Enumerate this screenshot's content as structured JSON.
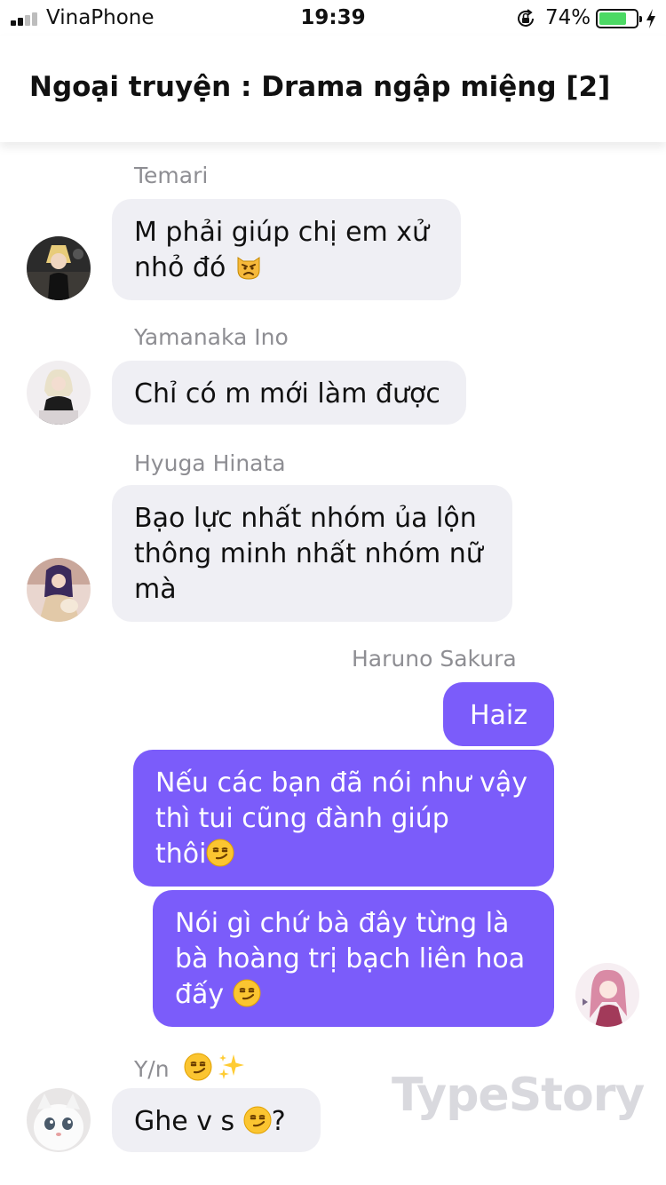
{
  "status_bar": {
    "carrier": "VinaPhone",
    "time": "19:39",
    "battery_percent": "74%",
    "battery_level": 0.74,
    "battery_color": "#4cd964",
    "icons": [
      "signal-icon",
      "rotation-lock-icon",
      "battery-icon",
      "charging-bolt-icon"
    ]
  },
  "header": {
    "title": "Ngoại truyện : Drama ngập miệng [2]"
  },
  "colors": {
    "outgoing_bubble": "#7b5cfa",
    "incoming_bubble": "#efeff4",
    "sender_name": "#8e8e93"
  },
  "messages": [
    {
      "sender": "Temari",
      "direction": "incoming",
      "lines": [
        "M phải giúp chị em xử",
        "nhỏ đó"
      ],
      "emoji": "angry-cat-emoji"
    },
    {
      "sender": "Yamanaka Ino",
      "direction": "incoming",
      "lines": [
        "Chỉ có m mới làm được"
      ]
    },
    {
      "sender": "Hyuga Hinata",
      "direction": "incoming",
      "lines": [
        "Bạo lực nhất nhóm ủa lộn",
        "thông minh nhất nhóm nữ",
        "mà"
      ]
    },
    {
      "sender": "Haruno Sakura",
      "direction": "outgoing",
      "lines": [
        "Haiz"
      ]
    },
    {
      "sender": "Haruno Sakura",
      "direction": "outgoing",
      "lines": [
        "Nếu các bạn đã nói như vậy",
        "thì tui cũng đành giúp",
        "thôi"
      ],
      "emoji": "smirk-emoji"
    },
    {
      "sender": "Haruno Sakura",
      "direction": "outgoing",
      "lines": [
        "Nói gì chứ bà đây từng là",
        "bà hoàng trị bạch liên hoa",
        "đấy"
      ],
      "emoji": "smirk-emoji"
    },
    {
      "sender": "Y/n",
      "sender_emojis": [
        "smirk-emoji",
        "sparkles-emoji"
      ],
      "direction": "incoming",
      "lines": [
        "Ghe v s",
        "?"
      ],
      "emoji": "smirk-emoji"
    }
  ],
  "watermark": "TypeStory"
}
